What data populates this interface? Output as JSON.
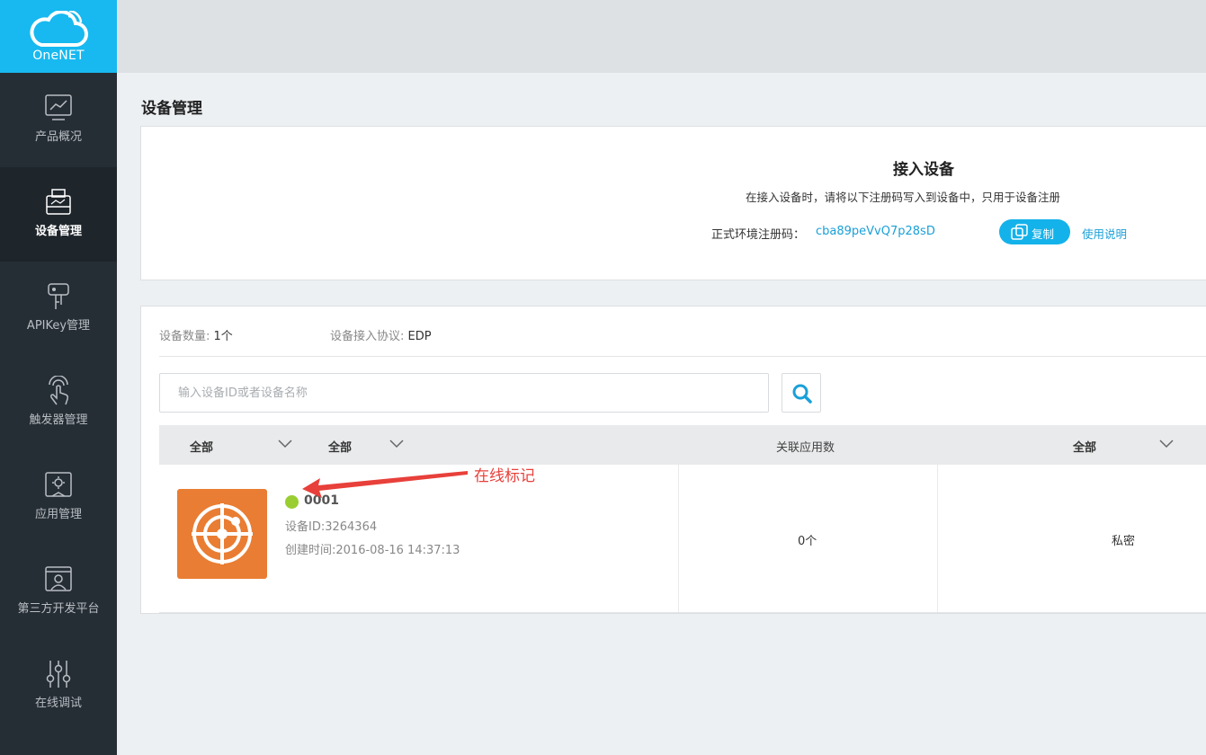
{
  "brand": {
    "name": "OneNET"
  },
  "sidebar": {
    "items": [
      {
        "label": "产品概况",
        "icon": "chart-icon"
      },
      {
        "label": "设备管理",
        "icon": "device-icon",
        "active": true
      },
      {
        "label": "APIKey管理",
        "icon": "key-icon"
      },
      {
        "label": "触发器管理",
        "icon": "touch-icon"
      },
      {
        "label": "应用管理",
        "icon": "app-gear-icon"
      },
      {
        "label": "第三方开发平台",
        "icon": "user-window-icon"
      },
      {
        "label": "在线调试",
        "icon": "sliders-icon"
      }
    ]
  },
  "page": {
    "title": "设备管理"
  },
  "access": {
    "title": "接入设备",
    "description": "在接入设备时，请将以下注册码写入到设备中，只用于设备注册",
    "reg_label": "正式环境注册码：",
    "reg_code": "cba89peVvQ7p28sD",
    "copy_label": "复制",
    "help_label": "使用说明"
  },
  "devices": {
    "count_label": "设备数量:",
    "count_value": "1个",
    "protocol_label": "设备接入协议:",
    "protocol_value": "EDP",
    "search_placeholder": "输入设备ID或者设备名称",
    "headers": {
      "filter1": "全部",
      "filter2": "全部",
      "app_count": "关联应用数",
      "filter3": "全部"
    },
    "rows": [
      {
        "name": "0001",
        "id_text": "设备ID:3264364",
        "created_text": "创建时间:2016-08-16 14:37:13",
        "app_count": "0个",
        "privacy": "私密",
        "online": true
      }
    ]
  },
  "annotation": {
    "text": "在线标记",
    "color": "#e8403a"
  },
  "colors": {
    "accent": "#14b2ea",
    "sidebar": "#262e35",
    "device_icon_bg": "#e97d33",
    "online": "#9acd32"
  }
}
